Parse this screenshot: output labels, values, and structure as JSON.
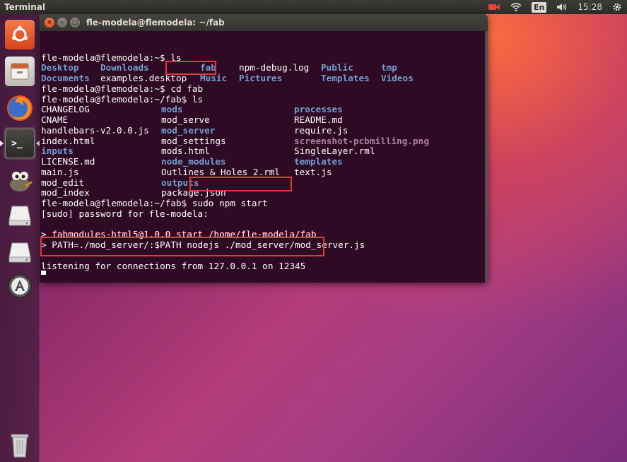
{
  "top_panel": {
    "app_name": "Terminal",
    "keyboard_layout": "En",
    "clock": "15:28",
    "icons": [
      "camera-icon",
      "wifi-icon",
      "keyboard-icon",
      "volume-icon",
      "power-gear-icon"
    ]
  },
  "launcher": {
    "items": [
      {
        "name": "ubuntu-dash-icon",
        "color": "#e95420"
      },
      {
        "name": "files-icon",
        "color": "#cfcbc4"
      },
      {
        "name": "firefox-icon",
        "color": "#ff7a1a"
      },
      {
        "name": "terminal-icon",
        "color": "#2b2a26"
      },
      {
        "name": "gimp-icon",
        "color": "#6f6a58"
      },
      {
        "name": "drive-icon",
        "color": "#c9c9c9"
      },
      {
        "name": "drive-icon-2",
        "color": "#c9c9c9"
      },
      {
        "name": "software-updater-icon",
        "color": "#808080"
      },
      {
        "name": "trash-icon",
        "color": "#b0b0b0"
      }
    ]
  },
  "window": {
    "title": "fle-modela@flemodela: ~/fab",
    "close_glyph": "×",
    "min_glyph": "–",
    "max_glyph": "□"
  },
  "terminal": {
    "colors": {
      "background": "#2e0a24",
      "text": "#ffffff",
      "dir": "#729fcf",
      "image": "#ad7fa8",
      "highlight": "#e03a3a"
    },
    "lines": [
      {
        "cells": [
          {
            "text": "fle-modela@flemodela:~$ ls"
          }
        ]
      },
      {
        "cells": [
          {
            "text": "Desktop",
            "cls": "b"
          },
          {
            "text": "Downloads",
            "cls": "b"
          },
          {
            "text": "fab",
            "cls": "b"
          },
          {
            "text": "npm-debug.log"
          },
          {
            "text": "Public",
            "cls": "b"
          },
          {
            "text": "tmp",
            "cls": "b"
          }
        ]
      },
      {
        "cells": [
          {
            "text": "Documents",
            "cls": "b"
          },
          {
            "text": "examples.desktop"
          },
          {
            "text": "Music",
            "cls": "b"
          },
          {
            "text": "Pictures",
            "cls": "b"
          },
          {
            "text": "Templates",
            "cls": "b"
          },
          {
            "text": "Videos",
            "cls": "b"
          }
        ]
      },
      {
        "cells": [
          {
            "text": "fle-modela@flemodela:~$ cd fab"
          }
        ]
      },
      {
        "cells": [
          {
            "text": "fle-modela@flemodela:~/fab$ ls"
          }
        ]
      },
      {
        "cells": [
          {
            "text": "CHANGELOG"
          },
          {
            "text": "mods",
            "cls": "b"
          },
          {
            "text": "processes",
            "cls": "b"
          }
        ]
      },
      {
        "cells": [
          {
            "text": "CNAME"
          },
          {
            "text": "mod_serve"
          },
          {
            "text": "README.md"
          }
        ]
      },
      {
        "cells": [
          {
            "text": "handlebars-v2.0.0.js"
          },
          {
            "text": "mod_server",
            "cls": "b"
          },
          {
            "text": "require.js"
          }
        ]
      },
      {
        "cells": [
          {
            "text": "index.html"
          },
          {
            "text": "mod_settings"
          },
          {
            "text": "screenshot-pcbmilling.png",
            "cls": "c"
          }
        ]
      },
      {
        "cells": [
          {
            "text": "inputs",
            "cls": "b"
          },
          {
            "text": "mods.html"
          },
          {
            "text": "SingleLayer.rml"
          }
        ]
      },
      {
        "cells": [
          {
            "text": "LICENSE.md"
          },
          {
            "text": "node_modules",
            "cls": "b"
          },
          {
            "text": "templates",
            "cls": "b"
          }
        ]
      },
      {
        "cells": [
          {
            "text": "main.js"
          },
          {
            "text": "Outlines & Holes 2.rml"
          },
          {
            "text": "text.js"
          }
        ]
      },
      {
        "cells": [
          {
            "text": "mod_edit"
          },
          {
            "text": "outputs",
            "cls": "b"
          }
        ]
      },
      {
        "cells": [
          {
            "text": "mod_index"
          },
          {
            "text": "package.json"
          }
        ]
      },
      {
        "cells": [
          {
            "text": "fle-modela@flemodela:~/fab$ sudo npm start"
          }
        ]
      },
      {
        "cells": [
          {
            "text": "[sudo] password for fle-modela:"
          }
        ]
      },
      {
        "cells": [
          {
            "text": ""
          }
        ]
      },
      {
        "cells": [
          {
            "text": "> fabmodules-html5@1.0.0 start /home/fle-modela/fab"
          }
        ]
      },
      {
        "cells": [
          {
            "text": "> PATH=./mod_server/:$PATH nodejs ./mod_server/mod_server.js"
          }
        ]
      },
      {
        "cells": [
          {
            "text": ""
          }
        ]
      },
      {
        "cells": [
          {
            "text": "listening for connections from 127.0.0.1 on 12345"
          }
        ]
      }
    ],
    "highlights": [
      "cd-fab-highlight",
      "sudo-npm-start-highlight",
      "listening-output-highlight"
    ]
  }
}
